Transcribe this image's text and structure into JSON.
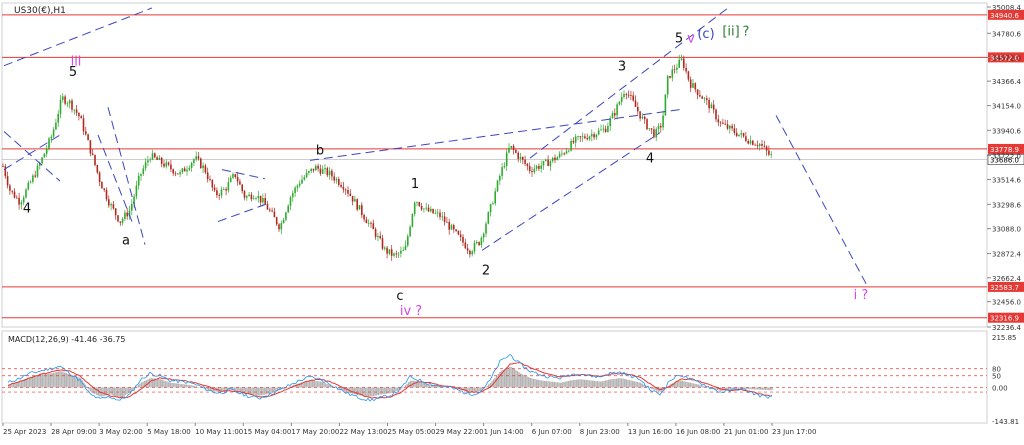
{
  "chart_data": {
    "type": "candlestick",
    "symbol": "US30(€),H1",
    "ylim": [
      32236.4,
      35008.4
    ],
    "price_ticks": [
      "35008.4",
      "34780.6",
      "34572.0",
      "34366.4",
      "34154.0",
      "33940.6",
      "33722.0",
      "33514.6",
      "33298.6",
      "33088.0",
      "32872.4",
      "32662.4",
      "32456.0",
      "32236.4"
    ],
    "horizontal_levels": [
      {
        "value": 34940.6,
        "label": "34940.6",
        "color": "#e53935"
      },
      {
        "value": 34572.0,
        "label": "34572.0",
        "color": "#e53935"
      },
      {
        "value": 33778.9,
        "label": "33778.9",
        "color": "#e53935"
      },
      {
        "value": 33686.0,
        "label": "33686.0",
        "color": "#ffffff"
      },
      {
        "value": 32583.7,
        "label": "32583.7",
        "color": "#e53935"
      },
      {
        "value": 32316.9,
        "label": "32316.9",
        "color": "#e53935"
      }
    ],
    "current_price": 33686.0,
    "x_labels": [
      "25 Apr 2023",
      "28 Apr 09:00",
      "3 May 02:00",
      "5 May 18:00",
      "10 May 11:00",
      "15 May 04:00",
      "17 May 20:00",
      "22 May 13:00",
      "25 May 05:00",
      "29 May 22:00",
      "1 Jun 14:00",
      "6 Jun 07:00",
      "8 Jun 23:00",
      "13 Jun 16:00",
      "16 Jun 08:00",
      "21 Jun 01:00",
      "23 Jun 17:00"
    ],
    "price_path": [
      [
        0,
        33720
      ],
      [
        10,
        33420
      ],
      [
        20,
        33320
      ],
      [
        30,
        33480
      ],
      [
        40,
        33650
      ],
      [
        52,
        33900
      ],
      [
        62,
        34220
      ],
      [
        70,
        34180
      ],
      [
        80,
        34050
      ],
      [
        90,
        33780
      ],
      [
        100,
        33500
      ],
      [
        110,
        33300
      ],
      [
        120,
        33150
      ],
      [
        130,
        33250
      ],
      [
        140,
        33550
      ],
      [
        150,
        33720
      ],
      [
        165,
        33640
      ],
      [
        180,
        33560
      ],
      [
        195,
        33700
      ],
      [
        205,
        33600
      ],
      [
        215,
        33380
      ],
      [
        225,
        33430
      ],
      [
        235,
        33560
      ],
      [
        245,
        33360
      ],
      [
        255,
        33390
      ],
      [
        265,
        33300
      ],
      [
        280,
        33100
      ],
      [
        290,
        33360
      ],
      [
        300,
        33500
      ],
      [
        315,
        33620
      ],
      [
        330,
        33560
      ],
      [
        345,
        33450
      ],
      [
        360,
        33250
      ],
      [
        375,
        33050
      ],
      [
        385,
        32900
      ],
      [
        395,
        32850
      ],
      [
        405,
        32900
      ],
      [
        415,
        33350
      ],
      [
        425,
        33250
      ],
      [
        440,
        33200
      ],
      [
        450,
        33100
      ],
      [
        460,
        33000
      ],
      [
        470,
        32900
      ],
      [
        480,
        32980
      ],
      [
        490,
        33250
      ],
      [
        500,
        33550
      ],
      [
        510,
        33800
      ],
      [
        520,
        33700
      ],
      [
        530,
        33600
      ],
      [
        545,
        33650
      ],
      [
        560,
        33720
      ],
      [
        575,
        33850
      ],
      [
        590,
        33900
      ],
      [
        605,
        33950
      ],
      [
        615,
        34100
      ],
      [
        625,
        34300
      ],
      [
        635,
        34150
      ],
      [
        645,
        34000
      ],
      [
        655,
        33900
      ],
      [
        662,
        34000
      ],
      [
        668,
        34400
      ],
      [
        675,
        34480
      ],
      [
        682,
        34550
      ],
      [
        690,
        34350
      ],
      [
        700,
        34250
      ],
      [
        710,
        34150
      ],
      [
        720,
        34000
      ],
      [
        730,
        33950
      ],
      [
        740,
        33900
      ],
      [
        750,
        33850
      ],
      [
        760,
        33820
      ],
      [
        770,
        33720
      ]
    ],
    "trend_lines": [
      {
        "from": [
          4,
          34500
        ],
        "to": [
          152,
          35000
        ]
      },
      {
        "from": [
          4,
          33930
        ],
        "to": [
          60,
          33500
        ]
      },
      {
        "from": [
          4,
          33600
        ],
        "to": [
          60,
          33900
        ]
      },
      {
        "from": [
          108,
          34140
        ],
        "to": [
          145,
          32950
        ]
      },
      {
        "from": [
          98,
          33900
        ],
        "to": [
          132,
          33150
        ]
      },
      {
        "from": [
          222,
          33600
        ],
        "to": [
          265,
          33520
        ]
      },
      {
        "from": [
          218,
          33150
        ],
        "to": [
          266,
          33300
        ]
      },
      {
        "from": [
          310,
          33680
        ],
        "to": [
          680,
          34120
        ]
      },
      {
        "from": [
          482,
          32900
        ],
        "to": [
          660,
          33920
        ]
      },
      {
        "from": [
          530,
          33700
        ],
        "to": [
          728,
          35000
        ]
      },
      {
        "from": [
          776,
          34070
        ],
        "to": [
          868,
          32580
        ]
      }
    ],
    "wave_labels": [
      {
        "text": "4",
        "x": 27,
        "price": 33230,
        "color": "#111111"
      },
      {
        "text": "5",
        "x": 73,
        "price": 34410,
        "color": "#111111"
      },
      {
        "text": "iii",
        "x": 76,
        "price": 34500,
        "color": "#d946ef"
      },
      {
        "text": "a",
        "x": 126,
        "price": 32950,
        "color": "#111111"
      },
      {
        "text": "b",
        "x": 320,
        "price": 33730,
        "color": "#111111"
      },
      {
        "text": "1",
        "x": 415,
        "price": 33440,
        "color": "#111111"
      },
      {
        "text": "c",
        "x": 400,
        "price": 32470,
        "color": "#111111"
      },
      {
        "text": "iv ?",
        "x": 411,
        "price": 32340,
        "color": "#d946ef"
      },
      {
        "text": "2",
        "x": 486,
        "price": 32690,
        "color": "#111111"
      },
      {
        "text": "3",
        "x": 622,
        "price": 34460,
        "color": "#111111"
      },
      {
        "text": "4",
        "x": 650,
        "price": 33660,
        "color": "#111111"
      },
      {
        "text": "5",
        "x": 679,
        "price": 34700,
        "color": "#111111"
      },
      {
        "text": "v",
        "x": 691,
        "price": 34700,
        "color": "#d946ef"
      },
      {
        "text": "(c)",
        "x": 706,
        "price": 34740,
        "color": "#3b45c4"
      },
      {
        "text": "[ii]",
        "x": 731,
        "price": 34760,
        "color": "#2e7d32"
      },
      {
        "text": "?",
        "x": 746,
        "price": 34760,
        "color": "#2e7d32"
      },
      {
        "text": "i ?",
        "x": 861,
        "price": 32480,
        "color": "#d946ef"
      }
    ],
    "macd": {
      "title": "MACD(12,26,9) -41.46 -36.75",
      "ylim": [
        -143.81,
        215.85
      ],
      "ticks": [
        "215.85",
        "80",
        "50",
        "0.00",
        "-143.81"
      ],
      "levels_dashed": [
        80,
        50,
        0,
        -20
      ],
      "histogram": [
        [
          8,
          10
        ],
        [
          20,
          30
        ],
        [
          30,
          45
        ],
        [
          40,
          55
        ],
        [
          50,
          60
        ],
        [
          60,
          70
        ],
        [
          70,
          55
        ],
        [
          80,
          40
        ],
        [
          90,
          -20
        ],
        [
          100,
          -40
        ],
        [
          110,
          -30
        ],
        [
          120,
          -45
        ],
        [
          130,
          -20
        ],
        [
          140,
          20
        ],
        [
          150,
          40
        ],
        [
          160,
          35
        ],
        [
          170,
          20
        ],
        [
          180,
          15
        ],
        [
          190,
          10
        ],
        [
          200,
          0
        ],
        [
          210,
          -15
        ],
        [
          220,
          -20
        ],
        [
          230,
          -10
        ],
        [
          240,
          -20
        ],
        [
          250,
          -30
        ],
        [
          260,
          -35
        ],
        [
          270,
          -25
        ],
        [
          280,
          -10
        ],
        [
          290,
          5
        ],
        [
          300,
          20
        ],
        [
          310,
          30
        ],
        [
          320,
          25
        ],
        [
          330,
          10
        ],
        [
          340,
          -10
        ],
        [
          350,
          -25
        ],
        [
          360,
          -35
        ],
        [
          370,
          -40
        ],
        [
          380,
          -30
        ],
        [
          390,
          -25
        ],
        [
          400,
          -10
        ],
        [
          410,
          30
        ],
        [
          420,
          25
        ],
        [
          430,
          10
        ],
        [
          440,
          5
        ],
        [
          450,
          0
        ],
        [
          460,
          -10
        ],
        [
          470,
          -20
        ],
        [
          480,
          -15
        ],
        [
          490,
          20
        ],
        [
          500,
          70
        ],
        [
          510,
          90
        ],
        [
          520,
          60
        ],
        [
          530,
          40
        ],
        [
          540,
          30
        ],
        [
          550,
          25
        ],
        [
          560,
          20
        ],
        [
          570,
          30
        ],
        [
          580,
          35
        ],
        [
          590,
          30
        ],
        [
          600,
          25
        ],
        [
          610,
          35
        ],
        [
          620,
          40
        ],
        [
          630,
          30
        ],
        [
          640,
          20
        ],
        [
          650,
          -5
        ],
        [
          660,
          -20
        ],
        [
          670,
          15
        ],
        [
          680,
          30
        ],
        [
          690,
          20
        ],
        [
          700,
          10
        ],
        [
          710,
          -5
        ],
        [
          720,
          -15
        ],
        [
          730,
          -10
        ],
        [
          740,
          -5
        ],
        [
          750,
          -8
        ],
        [
          760,
          -10
        ],
        [
          770,
          -12
        ]
      ],
      "macd_line": [
        [
          8,
          20
        ],
        [
          20,
          40
        ],
        [
          30,
          60
        ],
        [
          40,
          70
        ],
        [
          50,
          80
        ],
        [
          60,
          90
        ],
        [
          70,
          60
        ],
        [
          80,
          30
        ],
        [
          90,
          -30
        ],
        [
          100,
          -50
        ],
        [
          110,
          -40
        ],
        [
          120,
          -55
        ],
        [
          130,
          -30
        ],
        [
          140,
          30
        ],
        [
          150,
          60
        ],
        [
          160,
          50
        ],
        [
          170,
          30
        ],
        [
          180,
          25
        ],
        [
          190,
          20
        ],
        [
          200,
          5
        ],
        [
          210,
          -15
        ],
        [
          220,
          -25
        ],
        [
          230,
          -10
        ],
        [
          240,
          -25
        ],
        [
          250,
          -40
        ],
        [
          260,
          -45
        ],
        [
          270,
          -30
        ],
        [
          280,
          -10
        ],
        [
          290,
          10
        ],
        [
          300,
          30
        ],
        [
          310,
          45
        ],
        [
          320,
          35
        ],
        [
          330,
          15
        ],
        [
          340,
          -10
        ],
        [
          350,
          -30
        ],
        [
          360,
          -45
        ],
        [
          370,
          -55
        ],
        [
          380,
          -45
        ],
        [
          390,
          -35
        ],
        [
          400,
          -10
        ],
        [
          410,
          45
        ],
        [
          420,
          30
        ],
        [
          430,
          15
        ],
        [
          440,
          5
        ],
        [
          450,
          0
        ],
        [
          460,
          -15
        ],
        [
          470,
          -30
        ],
        [
          480,
          -20
        ],
        [
          490,
          30
        ],
        [
          500,
          110
        ],
        [
          510,
          140
        ],
        [
          520,
          100
        ],
        [
          530,
          70
        ],
        [
          540,
          55
        ],
        [
          550,
          45
        ],
        [
          560,
          40
        ],
        [
          570,
          55
        ],
        [
          580,
          60
        ],
        [
          590,
          50
        ],
        [
          600,
          45
        ],
        [
          610,
          60
        ],
        [
          620,
          65
        ],
        [
          630,
          50
        ],
        [
          640,
          35
        ],
        [
          650,
          -10
        ],
        [
          660,
          -30
        ],
        [
          670,
          30
        ],
        [
          680,
          55
        ],
        [
          690,
          35
        ],
        [
          700,
          20
        ],
        [
          710,
          0
        ],
        [
          720,
          -20
        ],
        [
          730,
          -15
        ],
        [
          740,
          -5
        ],
        [
          750,
          -20
        ],
        [
          760,
          -35
        ],
        [
          770,
          -41
        ]
      ],
      "signal_line": [
        [
          8,
          10
        ],
        [
          20,
          25
        ],
        [
          30,
          40
        ],
        [
          40,
          55
        ],
        [
          50,
          65
        ],
        [
          60,
          75
        ],
        [
          70,
          70
        ],
        [
          80,
          50
        ],
        [
          90,
          10
        ],
        [
          100,
          -20
        ],
        [
          110,
          -35
        ],
        [
          120,
          -45
        ],
        [
          130,
          -40
        ],
        [
          140,
          -10
        ],
        [
          150,
          25
        ],
        [
          160,
          40
        ],
        [
          170,
          35
        ],
        [
          180,
          30
        ],
        [
          190,
          25
        ],
        [
          200,
          15
        ],
        [
          210,
          0
        ],
        [
          220,
          -15
        ],
        [
          230,
          -15
        ],
        [
          240,
          -20
        ],
        [
          250,
          -30
        ],
        [
          260,
          -40
        ],
        [
          270,
          -35
        ],
        [
          280,
          -20
        ],
        [
          290,
          0
        ],
        [
          300,
          15
        ],
        [
          310,
          30
        ],
        [
          320,
          35
        ],
        [
          330,
          25
        ],
        [
          340,
          5
        ],
        [
          350,
          -15
        ],
        [
          360,
          -30
        ],
        [
          370,
          -45
        ],
        [
          380,
          -45
        ],
        [
          390,
          -40
        ],
        [
          400,
          -25
        ],
        [
          410,
          10
        ],
        [
          420,
          25
        ],
        [
          430,
          20
        ],
        [
          440,
          10
        ],
        [
          450,
          5
        ],
        [
          460,
          -5
        ],
        [
          470,
          -20
        ],
        [
          480,
          -20
        ],
        [
          490,
          0
        ],
        [
          500,
          50
        ],
        [
          510,
          100
        ],
        [
          520,
          105
        ],
        [
          530,
          85
        ],
        [
          540,
          70
        ],
        [
          550,
          55
        ],
        [
          560,
          45
        ],
        [
          570,
          50
        ],
        [
          580,
          55
        ],
        [
          590,
          52
        ],
        [
          600,
          48
        ],
        [
          610,
          55
        ],
        [
          620,
          60
        ],
        [
          630,
          55
        ],
        [
          640,
          45
        ],
        [
          650,
          15
        ],
        [
          660,
          -10
        ],
        [
          670,
          5
        ],
        [
          680,
          35
        ],
        [
          690,
          35
        ],
        [
          700,
          25
        ],
        [
          710,
          10
        ],
        [
          720,
          -5
        ],
        [
          730,
          -12
        ],
        [
          740,
          -10
        ],
        [
          750,
          -15
        ],
        [
          760,
          -28
        ],
        [
          770,
          -36.75
        ]
      ]
    }
  }
}
